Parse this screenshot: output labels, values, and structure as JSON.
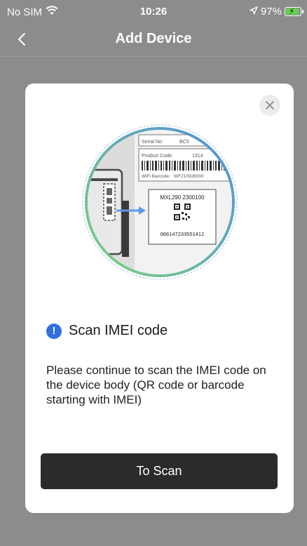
{
  "status_bar": {
    "carrier": "No SIM",
    "time": "10:26",
    "battery": "97%",
    "battery_level": 0.97,
    "icons": [
      "wifi-icon",
      "location-arrow-icon",
      "battery-charging-icon"
    ]
  },
  "nav": {
    "title": "Add Device",
    "back_icon": "chevron-left-icon"
  },
  "modal": {
    "close_icon": "close-icon",
    "illustration": {
      "serial_label": "Serial No:",
      "serial_value": "BC5",
      "product_label": "Product Code:",
      "product_value": "1314",
      "wifi_label": "WiFi Barcode:",
      "wifi_value": "WF210926000",
      "model": "MXL290 2300100",
      "imei": "866147233551412"
    },
    "info_icon": "exclamation-circle-icon",
    "title": "Scan IMEI code",
    "description": "Please continue to scan the IMEI code on the device body (QR code or barcode starting with IMEI)",
    "button_label": "To Scan"
  },
  "colors": {
    "overlay": "#8c8c8c",
    "modal_bg": "#ffffff",
    "button_bg": "#2b2b2b",
    "accent": "#2f6fe0",
    "battery": "#5fd34b"
  }
}
